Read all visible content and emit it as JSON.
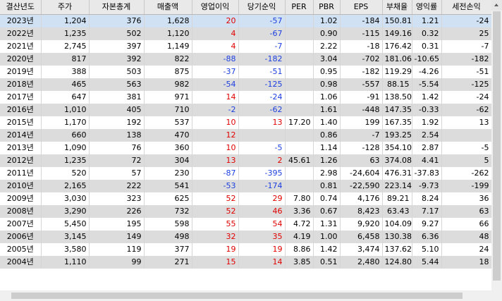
{
  "table": {
    "headers": [
      "결산년도",
      "주가",
      "자본총계",
      "매출액",
      "영업이익",
      "당기순익",
      "PER",
      "PBR",
      "EPS",
      "부채율",
      "영익률",
      "세전손익"
    ],
    "rows": [
      [
        "2023년",
        "1,204",
        "376",
        "1,628",
        "20",
        "-57",
        "",
        "1.02",
        "-184",
        "150.81",
        "1.21",
        "-24"
      ],
      [
        "2022년",
        "1,235",
        "502",
        "1,120",
        "4",
        "-67",
        "",
        "0.90",
        "-115",
        "149.16",
        "0.32",
        "25"
      ],
      [
        "2021년",
        "2,745",
        "397",
        "1,149",
        "4",
        "-7",
        "",
        "2.22",
        "-18",
        "176.42",
        "0.31",
        "-7"
      ],
      [
        "2020년",
        "817",
        "392",
        "822",
        "-88",
        "-182",
        "",
        "3.04",
        "-702",
        "181.06",
        "-10.65",
        "-182"
      ],
      [
        "2019년",
        "388",
        "503",
        "875",
        "-37",
        "-51",
        "",
        "0.95",
        "-182",
        "119.29",
        "-4.26",
        "-51"
      ],
      [
        "2018년",
        "465",
        "563",
        "982",
        "-54",
        "-125",
        "",
        "0.98",
        "-557",
        "88.15",
        "-5.54",
        "-125"
      ],
      [
        "2017년",
        "647",
        "381",
        "971",
        "14",
        "-24",
        "",
        "1.06",
        "-91",
        "138.50",
        "1.42",
        "-24"
      ],
      [
        "2016년",
        "1,010",
        "405",
        "710",
        "-2",
        "-62",
        "",
        "1.61",
        "-448",
        "147.35",
        "-0.33",
        "-62"
      ],
      [
        "2015년",
        "1,170",
        "192",
        "537",
        "10",
        "13",
        "17.20",
        "1.40",
        "199",
        "167.35",
        "1.92",
        "13"
      ],
      [
        "2014년",
        "660",
        "138",
        "470",
        "12",
        "",
        "",
        "0.86",
        "-7",
        "193.25",
        "2.54",
        ""
      ],
      [
        "2013년",
        "1,090",
        "76",
        "360",
        "10",
        "-5",
        "",
        "1.14",
        "-128",
        "354.10",
        "2.87",
        "-5"
      ],
      [
        "2012년",
        "1,235",
        "72",
        "304",
        "13",
        "2",
        "45.61",
        "1.26",
        "63",
        "374.08",
        "4.41",
        "5"
      ],
      [
        "2011년",
        "520",
        "57",
        "230",
        "-87",
        "-395",
        "",
        "2.98",
        "-24,604",
        "476.31",
        "-37.83",
        "-262"
      ],
      [
        "2010년",
        "2,165",
        "222",
        "541",
        "-53",
        "-174",
        "",
        "0.81",
        "-22,590",
        "223.14",
        "-9.73",
        "-199"
      ],
      [
        "2009년",
        "3,030",
        "323",
        "625",
        "52",
        "29",
        "7.80",
        "0.74",
        "4,176",
        "89.21",
        "8.24",
        "36"
      ],
      [
        "2008년",
        "3,290",
        "226",
        "732",
        "52",
        "46",
        "3.36",
        "0.67",
        "8,423",
        "63.43",
        "7.17",
        "63"
      ],
      [
        "2007년",
        "5,450",
        "195",
        "598",
        "55",
        "54",
        "4.72",
        "1.31",
        "9,920",
        "104.09",
        "9.27",
        "66"
      ],
      [
        "2006년",
        "3,145",
        "149",
        "498",
        "32",
        "35",
        "4.19",
        "1.00",
        "6,458",
        "130.38",
        "6.36",
        "48"
      ],
      [
        "2005년",
        "3,580",
        "119",
        "377",
        "19",
        "19",
        "8.86",
        "1.42",
        "3,474",
        "137.62",
        "5.10",
        "24"
      ],
      [
        "2004년",
        "1,110",
        "99",
        "271",
        "15",
        "14",
        "3.85",
        "0.51",
        "2,480",
        "124.80",
        "5.44",
        "18"
      ]
    ],
    "selected_row": 0
  },
  "colors": {
    "negative": "#1d3fe0",
    "positive": "#e00000",
    "row_alt": "#dcdcdc",
    "row_selected": "#cfe1f3",
    "header_bg": "#e9e9e9"
  }
}
